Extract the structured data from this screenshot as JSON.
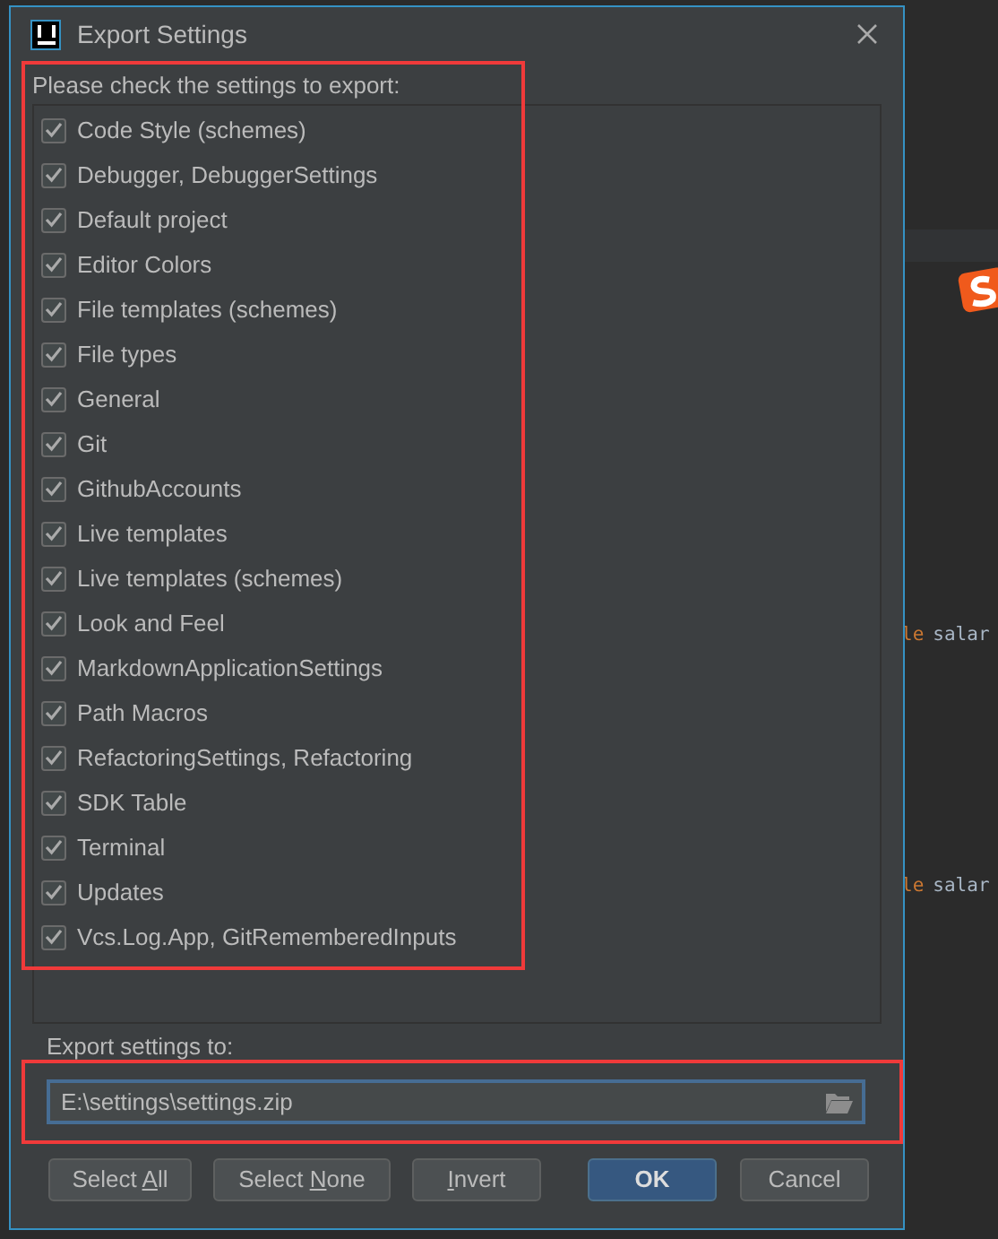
{
  "dialog": {
    "title": "Export Settings",
    "list_label": "Please check the settings to export:",
    "items": [
      {
        "label": "Code Style (schemes)",
        "checked": true
      },
      {
        "label": "Debugger, DebuggerSettings",
        "checked": true
      },
      {
        "label": "Default project",
        "checked": true
      },
      {
        "label": "Editor Colors",
        "checked": true
      },
      {
        "label": "File templates (schemes)",
        "checked": true
      },
      {
        "label": "File types",
        "checked": true
      },
      {
        "label": "General",
        "checked": true
      },
      {
        "label": "Git",
        "checked": true
      },
      {
        "label": "GithubAccounts",
        "checked": true
      },
      {
        "label": "Live templates",
        "checked": true
      },
      {
        "label": "Live templates (schemes)",
        "checked": true
      },
      {
        "label": "Look and Feel",
        "checked": true
      },
      {
        "label": "MarkdownApplicationSettings",
        "checked": true
      },
      {
        "label": "Path Macros",
        "checked": true
      },
      {
        "label": "RefactoringSettings, Refactoring",
        "checked": true
      },
      {
        "label": "SDK Table",
        "checked": true
      },
      {
        "label": "Terminal",
        "checked": true
      },
      {
        "label": "Updates",
        "checked": true
      },
      {
        "label": "Vcs.Log.App, GitRememberedInputs",
        "checked": true
      }
    ],
    "path_label": "Export settings to:",
    "path_value": "E:\\settings\\settings.zip",
    "buttons": [
      {
        "parts": [
          {
            "text": "Select ",
            "mnemonic": false
          },
          {
            "text": "A",
            "mnemonic": true
          },
          {
            "text": "ll",
            "mnemonic": false
          }
        ],
        "default": false
      },
      {
        "parts": [
          {
            "text": "Select ",
            "mnemonic": false
          },
          {
            "text": "N",
            "mnemonic": true
          },
          {
            "text": "one",
            "mnemonic": false
          }
        ],
        "default": false
      },
      {
        "parts": [
          {
            "text": "I",
            "mnemonic": true
          },
          {
            "text": "nvert",
            "mnemonic": false
          }
        ],
        "default": false
      },
      {
        "parts": [
          {
            "text": "OK",
            "mnemonic": false
          }
        ],
        "default": true
      },
      {
        "parts": [
          {
            "text": "Cancel",
            "mnemonic": false
          }
        ],
        "default": false
      }
    ]
  },
  "editor": {
    "lines": [
      {
        "keyword": "le",
        "text": "salar"
      },
      {
        "keyword": "le",
        "text": "salar"
      }
    ]
  }
}
